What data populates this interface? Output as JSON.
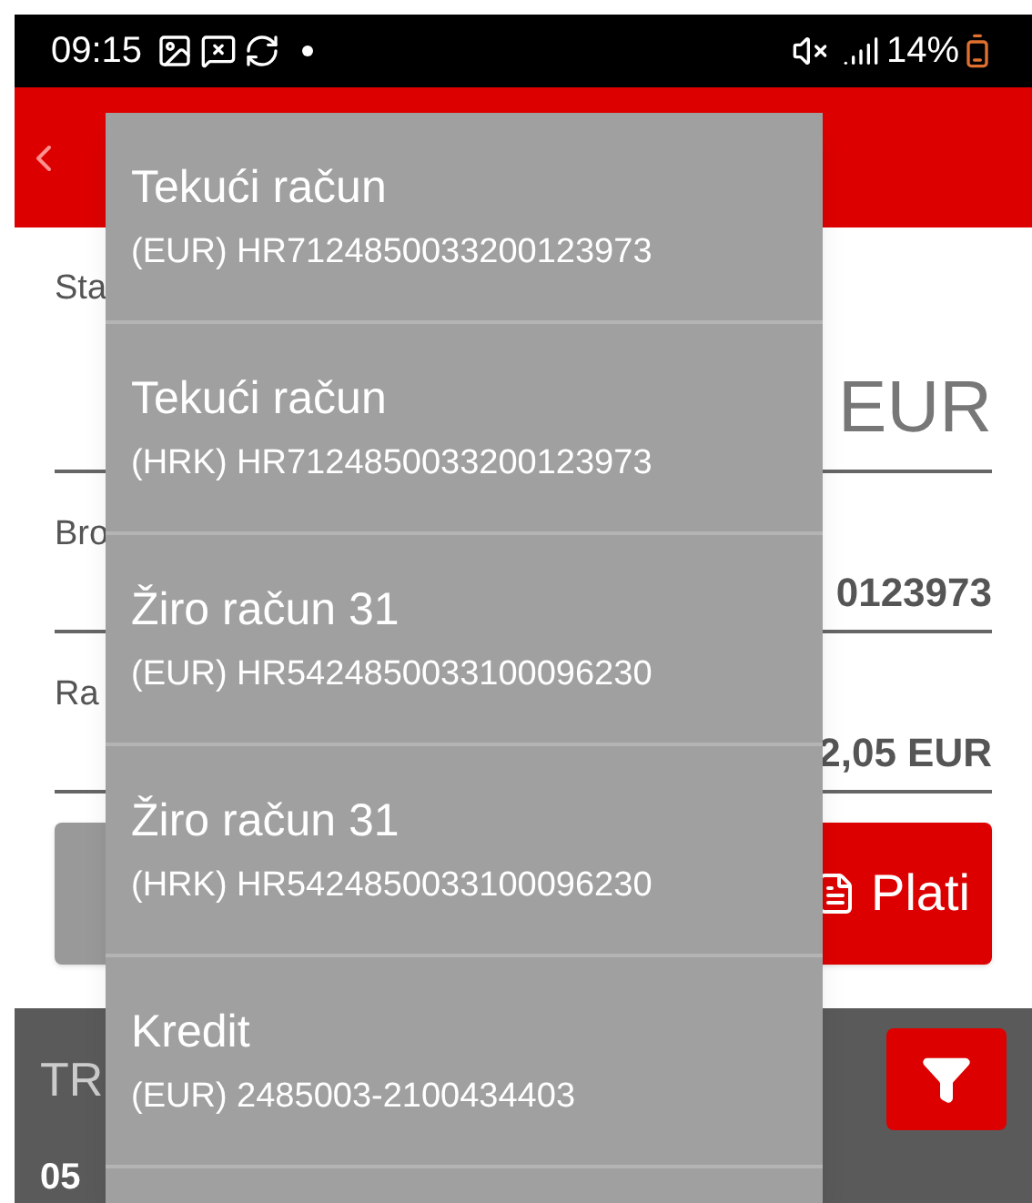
{
  "status_bar": {
    "time": "09:15",
    "battery": "14%"
  },
  "form": {
    "fields": [
      {
        "label": "Sta",
        "value": "EUR",
        "kind": "amount"
      },
      {
        "label": "Bro",
        "value": "0123973",
        "kind": "detail"
      },
      {
        "label": "Ra",
        "value": "2,05 EUR",
        "kind": "detail"
      }
    ]
  },
  "pay_button": {
    "label": "Plati"
  },
  "transactions": {
    "title": "TR",
    "first_date": "05"
  },
  "account_menu": {
    "items": [
      {
        "name": "Tekući račun",
        "number": "(EUR) HR7124850033200123973"
      },
      {
        "name": "Tekući račun",
        "number": "(HRK) HR7124850033200123973"
      },
      {
        "name": "Žiro račun 31",
        "number": "(EUR) HR5424850033100096230"
      },
      {
        "name": "Žiro račun 31",
        "number": "(HRK) HR5424850033100096230"
      },
      {
        "name": "Kredit",
        "number": "(EUR) 2485003-2100434403"
      }
    ]
  }
}
